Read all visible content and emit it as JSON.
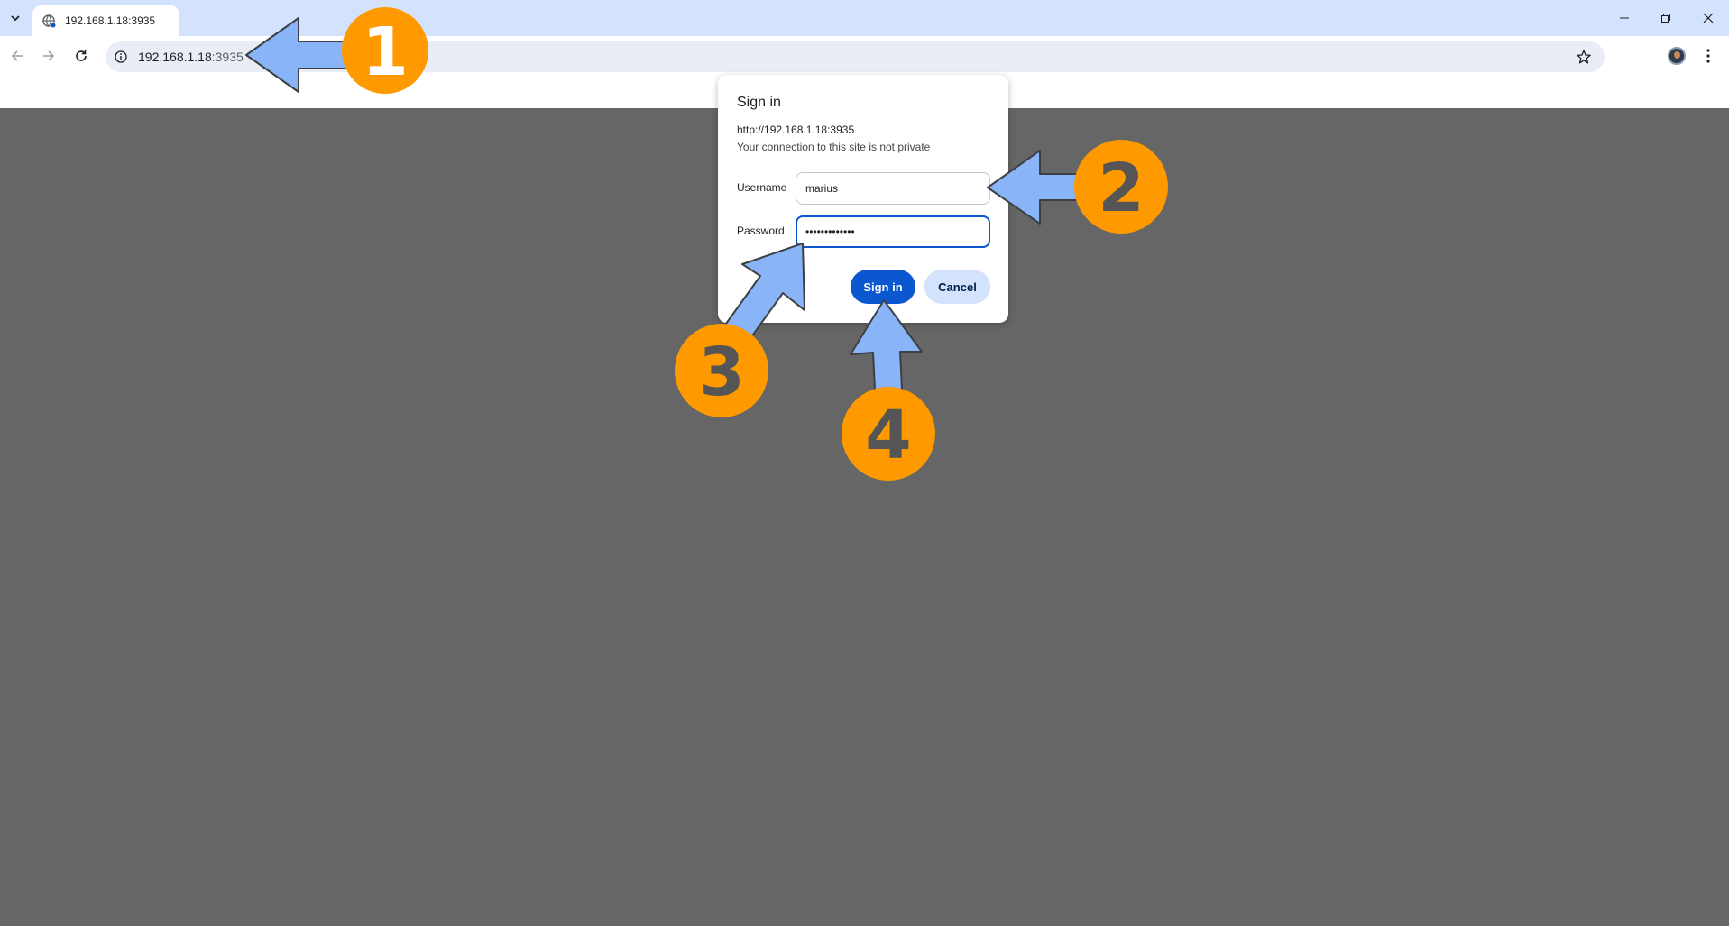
{
  "browser": {
    "tab_title": "192.168.1.18:3935",
    "url_host": "192.168.1.18",
    "url_port": ":3935"
  },
  "dialog": {
    "title": "Sign in",
    "origin": "http://192.168.1.18:3935",
    "warning": "Your connection to this site is not private",
    "username_label": "Username",
    "username_value": "marius",
    "password_label": "Password",
    "password_value": "•••••••••••••",
    "signin_label": "Sign in",
    "cancel_label": "Cancel"
  },
  "annotations": {
    "step1": "1",
    "step2": "2",
    "step3": "3",
    "step4": "4",
    "badge_color": "#ff9900",
    "badge_text_color": "#555555",
    "arrow_color": "#8ab4f8"
  },
  "colors": {
    "tabbar": "#d3e3fd",
    "page_background": "#666666",
    "primary_button": "#0b57d0"
  }
}
